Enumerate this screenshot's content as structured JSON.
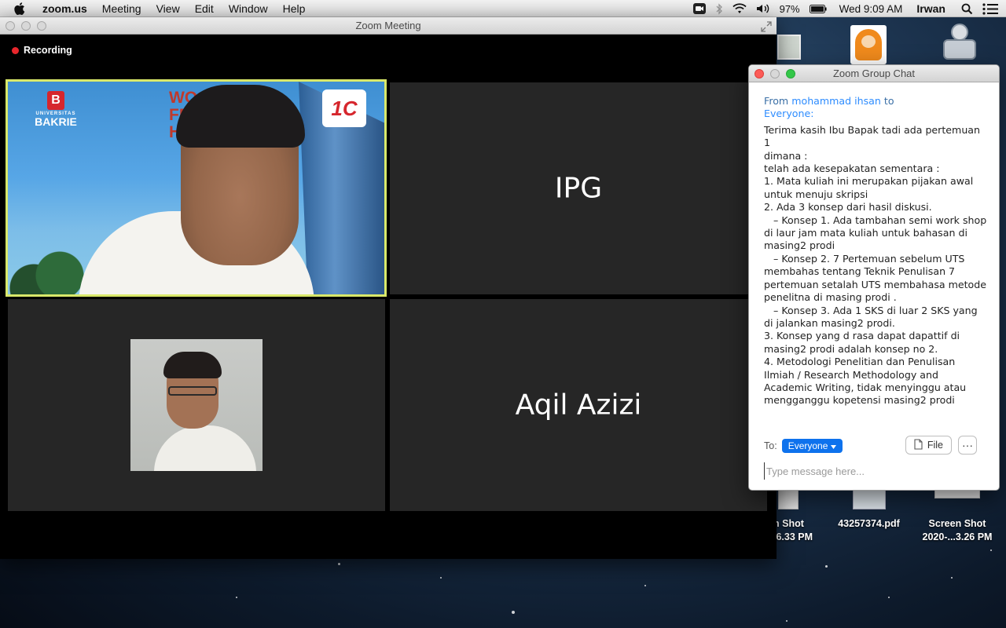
{
  "menubar": {
    "app": "zoom.us",
    "menus": [
      "Meeting",
      "View",
      "Edit",
      "Window",
      "Help"
    ],
    "battery": "97%",
    "clock": "Wed 9:09 AM",
    "user": "Irwan"
  },
  "meeting": {
    "window_title": "Zoom Meeting",
    "recording_label": "Recording",
    "tiles": [
      {
        "name": "IPG"
      },
      {
        "name": "Aqil Azizi"
      }
    ],
    "active_speaker_bg_text": [
      "WO",
      "FR",
      "HA"
    ]
  },
  "chat": {
    "window_title": "Zoom Group Chat",
    "from_label": "From",
    "sender": "mohammad ihsan",
    "to_word": "to",
    "recipient": "Everyone:",
    "message": "Terima kasih Ibu Bapak tadi ada pertemuan 1\ndimana :\ntelah ada kesepakatan sementara :\n1. Mata kuliah ini merupakan pijakan awal\nuntuk menuju skripsi\n2. Ada 3 konsep dari hasil diskusi.\n   – Konsep 1. Ada tambahan semi work shop\ndi laur jam mata kuliah untuk bahasan di\nmasing2 prodi\n   – Konsep 2. 7 Pertemuan sebelum UTS\nmembahas tentang Teknik Penulisan 7\npertemuan setalah UTS membahasa metode\npenelitna di masing prodi .\n   – Konsep 3. Ada 1 SKS di luar 2 SKS yang\ndi jalankan masing2 prodi.\n3. Konsep yang d rasa dapat dapattif di\nmasing2 prodi adalah konsep no 2.\n4. Metodologi Penelitian dan Penulisan\nIlmiah / Research Methodology and\nAcademic Writing, tidak menyinggu atau\nmengganggu kopetensi masing2 prodi",
    "to_label": "To:",
    "to_value": "Everyone",
    "file_label": "File",
    "more_label": "···",
    "input_placeholder": "Type message here..."
  },
  "desktop_icons": [
    {
      "line1": "n Shot",
      "line2": ".6.33 PM"
    },
    {
      "line1": "43257374.pdf",
      "line2": ""
    },
    {
      "line1": "Screen Shot",
      "line2": "2020-...3.26 PM"
    }
  ],
  "colors": {
    "accent": "#2d8cff",
    "active_speaker_border": "#d9e86a",
    "recording": "#e8262c",
    "tile_bg": "#262626"
  }
}
